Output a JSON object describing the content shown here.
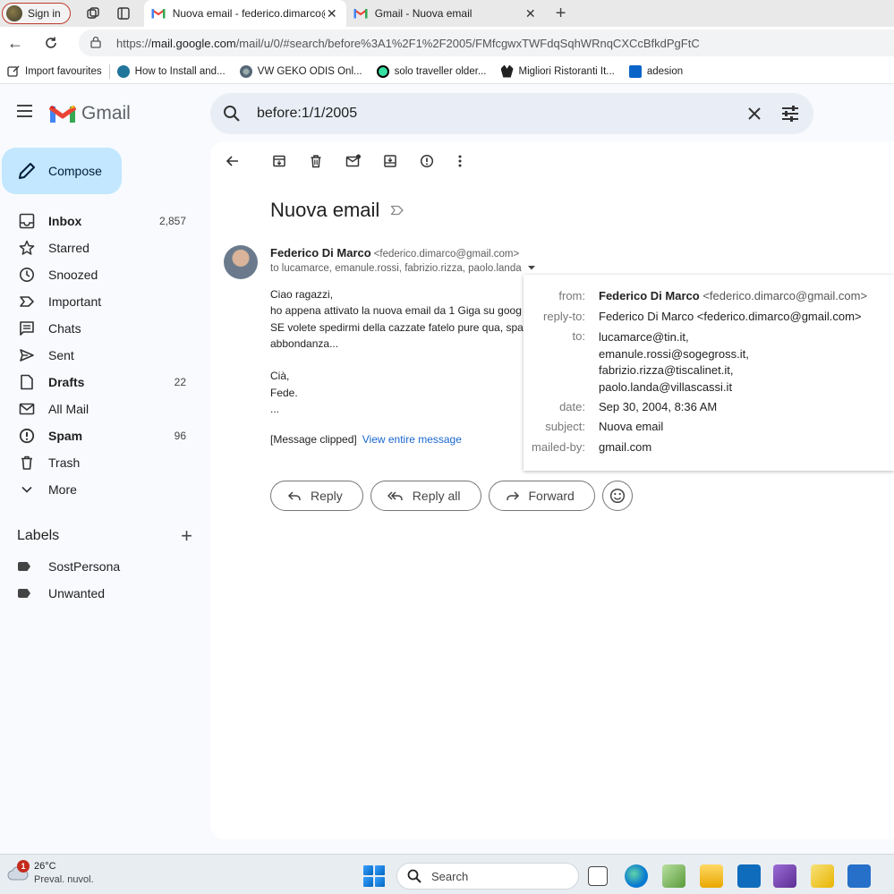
{
  "browser": {
    "signin_label": "Sign in",
    "tabs": [
      {
        "title": "Nuova email - federico.dimarco@",
        "active": true
      },
      {
        "title": "Gmail - Nuova email",
        "active": false
      }
    ],
    "url_prefix": "https://",
    "url_host": "mail.google.com",
    "url_path": "/mail/u/0/#search/before%3A1%2F1%2F2005/FMfcgwxTWFdqSqhWRnqCXCcBfkdPgFtC",
    "bookmarks": [
      {
        "label": "Import favourites",
        "icon": "import-icon"
      },
      {
        "label": "How to Install and...",
        "icon": "wordpress-icon"
      },
      {
        "label": "VW GEKO ODIS Onl...",
        "icon": "gear-icon"
      },
      {
        "label": "solo traveller older...",
        "icon": "tripadvisor-icon"
      },
      {
        "label": "Migliori Ristoranti It...",
        "icon": "bull-icon"
      },
      {
        "label": "adesion",
        "icon": "outlook-icon"
      }
    ]
  },
  "gmail": {
    "brand": "Gmail",
    "search_query": "before:1/1/2005",
    "compose_label": "Compose",
    "nav": [
      {
        "label": "Inbox",
        "count": "2,857",
        "bold": true,
        "icon": "inbox-icon"
      },
      {
        "label": "Starred",
        "count": "",
        "bold": false,
        "icon": "star-icon"
      },
      {
        "label": "Snoozed",
        "count": "",
        "bold": false,
        "icon": "clock-icon"
      },
      {
        "label": "Important",
        "count": "",
        "bold": false,
        "icon": "important-icon"
      },
      {
        "label": "Chats",
        "count": "",
        "bold": false,
        "icon": "chat-icon"
      },
      {
        "label": "Sent",
        "count": "",
        "bold": false,
        "icon": "send-icon"
      },
      {
        "label": "Drafts",
        "count": "22",
        "bold": true,
        "icon": "draft-icon"
      },
      {
        "label": "All Mail",
        "count": "",
        "bold": false,
        "icon": "mail-icon"
      },
      {
        "label": "Spam",
        "count": "96",
        "bold": true,
        "icon": "spam-icon"
      },
      {
        "label": "Trash",
        "count": "",
        "bold": false,
        "icon": "trash-icon"
      },
      {
        "label": "More",
        "count": "",
        "bold": false,
        "icon": "chevron-down-icon"
      }
    ],
    "labels_heading": "Labels",
    "labels": [
      "SostPersona",
      "Unwanted"
    ]
  },
  "message": {
    "subject": "Nuova email",
    "sender_name": "Federico Di Marco",
    "sender_email": "<federico.dimarco@gmail.com>",
    "recipients": "to lucamarce, emanule.rossi, fabrizio.rizza, paolo.landa",
    "body_lines": [
      "Ciao ragazzi,",
      "ho appena attivato la nuova email da 1 Giga su goog",
      "SE volete spedirmi della cazzate fatelo pure qua, spa",
      "abbondanza...",
      "",
      "Cià,",
      "Fede.",
      "..."
    ],
    "clipped_text": "[Message clipped]",
    "view_entire": "View entire message",
    "reply_label": "Reply",
    "reply_all_label": "Reply all",
    "forward_label": "Forward"
  },
  "details": {
    "from_key": "from:",
    "from_name": "Federico Di Marco",
    "from_email": "<federico.dimarco@gmail.com>",
    "replyto_key": "reply-to:",
    "replyto_value": "Federico Di Marco <federico.dimarco@gmail.com>",
    "to_key": "to:",
    "to_values": [
      "lucamarce@tin.it,",
      "emanule.rossi@sogegross.it,",
      "fabrizio.rizza@tiscalinet.it,",
      "paolo.landa@villascassi.it"
    ],
    "date_key": "date:",
    "date_value": "Sep 30, 2004, 8:36 AM",
    "subject_key": "subject:",
    "subject_value": "Nuova email",
    "mailedby_key": "mailed-by:",
    "mailedby_value": "gmail.com"
  },
  "taskbar": {
    "weather_badge": "1",
    "temperature": "26°C",
    "condition": "Preval. nuvol.",
    "search_label": "Search"
  },
  "colors": {
    "accent": "#c2e7ff",
    "link": "#1a67d2",
    "search_bg": "#e9eef6"
  }
}
